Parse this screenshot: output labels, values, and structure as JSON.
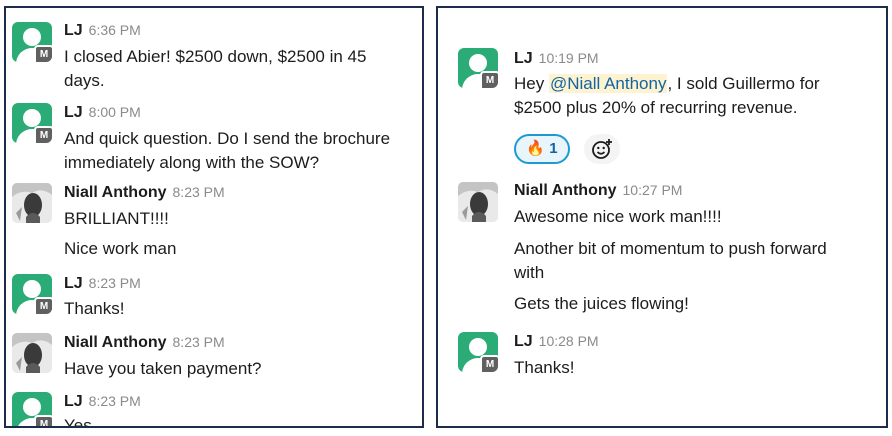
{
  "left_panel": {
    "messages": [
      {
        "user": "LJ",
        "time": "6:36 PM",
        "lines": [
          "I closed Abier! $2500 down, $2500 in 45",
          "days."
        ]
      },
      {
        "user": "LJ",
        "time": "8:00 PM",
        "lines": [
          "And quick question. Do I send the brochure",
          "immediately along with the SOW?"
        ]
      },
      {
        "user": "Niall Anthony",
        "time": "8:23 PM",
        "lines": [
          "BRILLIANT!!!!"
        ]
      },
      {
        "user": "",
        "time": "",
        "lines": [
          "Nice work man"
        ]
      },
      {
        "user": "LJ",
        "time": "8:23 PM",
        "lines": [
          "Thanks!"
        ]
      },
      {
        "user": "Niall Anthony",
        "time": "8:23 PM",
        "lines": [
          "Have you taken payment?"
        ]
      },
      {
        "user": "LJ",
        "time": "8:23 PM",
        "lines": [
          "Yes"
        ]
      }
    ]
  },
  "right_panel": {
    "messages": [
      {
        "user": "LJ",
        "time": "10:19 PM",
        "line1_prefix": "Hey ",
        "mention": "@Niall Anthony",
        "line1_suffix": ", I sold Guillermo for",
        "line2": "$2500 plus 20% of recurring revenue.",
        "reaction": {
          "emoji": "🔥",
          "count": "1"
        }
      },
      {
        "user": "Niall Anthony",
        "time": "10:27 PM",
        "lines": [
          "Awesome nice work man!!!!"
        ]
      },
      {
        "user": "",
        "time": "",
        "lines": [
          "Another bit of momentum to push forward",
          "with"
        ]
      },
      {
        "user": "",
        "time": "",
        "lines": [
          "Gets the juices flowing!"
        ]
      },
      {
        "user": "LJ",
        "time": "10:28 PM",
        "lines": [
          "Thanks!"
        ]
      }
    ]
  },
  "badge_letter": "M",
  "colors": {
    "avatar_green": "#2bac76",
    "mention_text": "#1264a3",
    "mention_bg": "#fdf3d1",
    "panel_border": "#1f2b4d",
    "reaction_border": "#1d9bd1"
  }
}
